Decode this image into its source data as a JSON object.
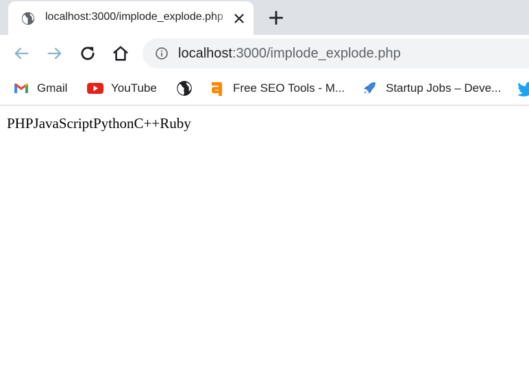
{
  "tab": {
    "title": "localhost:3000/implode_explode.php",
    "favicon_icon": "globe-icon",
    "close_icon": "close-icon"
  },
  "new_tab_icon": "plus-icon",
  "toolbar": {
    "back_icon": "back-arrow-icon",
    "forward_icon": "forward-arrow-icon",
    "reload_icon": "reload-icon",
    "home_icon": "home-icon",
    "site_info_icon": "info-icon"
  },
  "address_bar": {
    "host": "localhost",
    "rest": ":3000/implode_explode.php"
  },
  "bookmarks": [
    {
      "label": "Gmail",
      "icon": "gmail-icon"
    },
    {
      "label": "YouTube",
      "icon": "youtube-icon"
    },
    {
      "label": "",
      "icon": "globe-icon"
    },
    {
      "label": "Free SEO Tools - M...",
      "icon": "ahrefs-icon"
    },
    {
      "label": "Startup Jobs – Deve...",
      "icon": "rocket-icon"
    },
    {
      "label": "",
      "icon": "twitter-icon"
    }
  ],
  "colors": {
    "tabstrip_bg": "#dee1e6",
    "omnibox_bg": "#f1f3f4",
    "youtube_red": "#e62117",
    "ahrefs_orange": "#ff8800",
    "twitter_blue": "#1da1f2"
  },
  "page": {
    "output_text": "PHPJavaScriptPythonC++Ruby"
  }
}
